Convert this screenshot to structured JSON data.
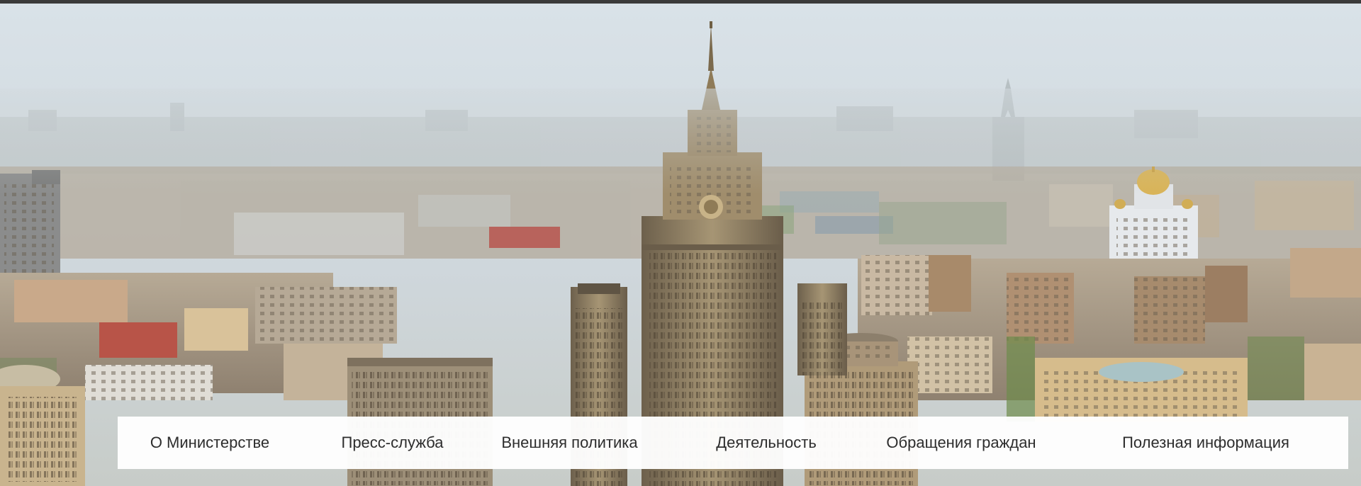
{
  "hero": {
    "image_alt": "Moscow skyline panorama with the Ministry of Foreign Affairs building"
  },
  "nav": {
    "items": [
      {
        "label": "О Министерстве"
      },
      {
        "label": "Пресс-служба"
      },
      {
        "label": "Внешняя политика"
      },
      {
        "label": "Деятельность"
      },
      {
        "label": "Обращения граждан"
      },
      {
        "label": "Полезная информация"
      }
    ]
  },
  "colors": {
    "nav_background": "#ffffff",
    "nav_text": "#2d2d2d",
    "top_strip": "#3a3a3a",
    "sky": "#d6dee4"
  },
  "icons": {
    "crest": "coat-of-arms-icon"
  }
}
